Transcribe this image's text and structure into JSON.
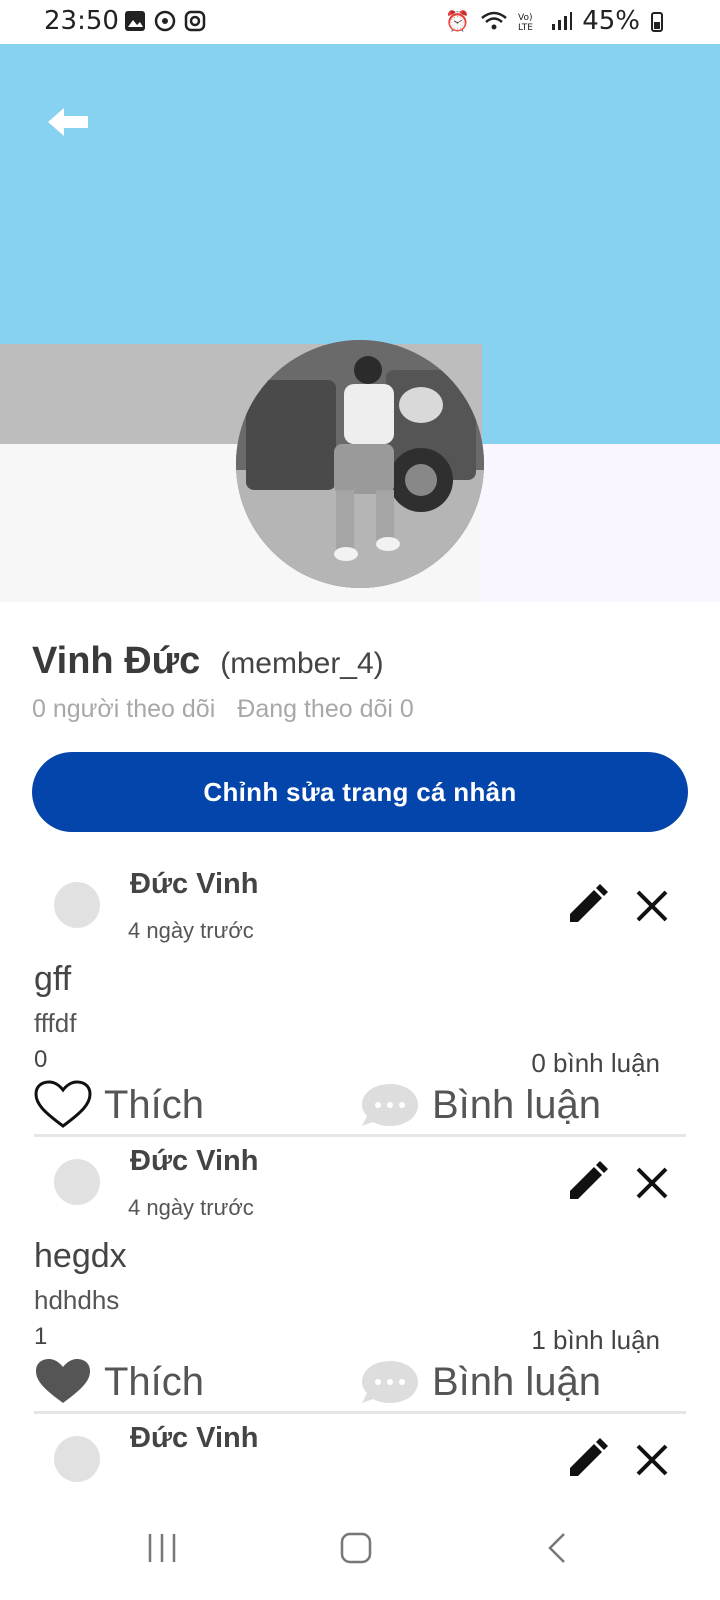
{
  "status_bar": {
    "time": "23:50",
    "battery": "45%"
  },
  "profile": {
    "name": "Vinh Đức",
    "username": "(member_4)",
    "followers": "0 người theo dõi",
    "following": "Đang theo dõi 0",
    "edit_button": "Chỉnh sửa trang cá nhân"
  },
  "posts": [
    {
      "author": "Đức Vinh",
      "time": "4 ngày trước",
      "title": "gff",
      "body": "fffdf",
      "likes": "0",
      "comments": "0 bình luận",
      "like_label": "Thích",
      "comment_label": "Bình luận",
      "liked": false
    },
    {
      "author": "Đức Vinh",
      "time": "4 ngày trước",
      "title": "hegdx",
      "body": "hdhdhs",
      "likes": "1",
      "comments": "1 bình luận",
      "like_label": "Thích",
      "comment_label": "Bình luận",
      "liked": true
    },
    {
      "author": "Đức Vinh"
    }
  ],
  "colors": {
    "cover": "#87d1f1",
    "primary_button": "#0445ab"
  }
}
